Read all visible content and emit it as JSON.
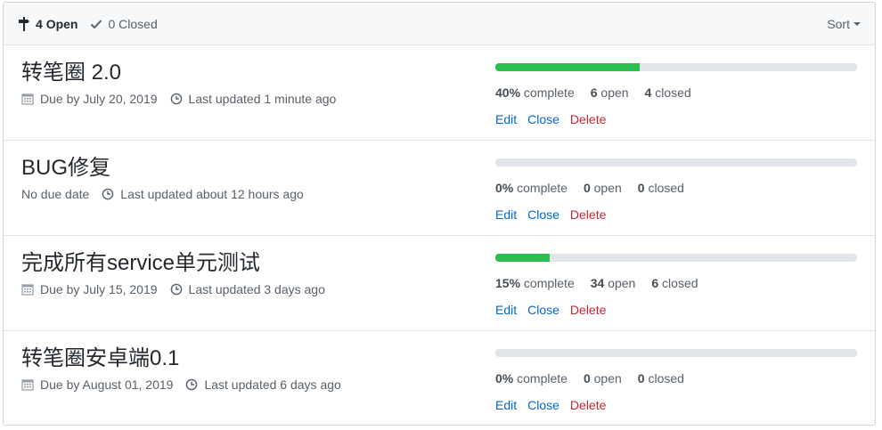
{
  "header": {
    "open_count": "4",
    "open_label": "Open",
    "closed_count": "0",
    "closed_label": "Closed",
    "sort_label": "Sort"
  },
  "milestones": [
    {
      "title": "转笔圈 2.0",
      "due": "Due by July 20, 2019",
      "has_due_icon": true,
      "updated": "Last updated 1 minute ago",
      "percent": 40,
      "percent_text": "40%",
      "complete_label": "complete",
      "open": "6",
      "open_label": "open",
      "closed": "4",
      "closed_label": "closed",
      "edit": "Edit",
      "close": "Close",
      "delete": "Delete"
    },
    {
      "title": "BUG修复",
      "due": "No due date",
      "has_due_icon": false,
      "updated": "Last updated about 12 hours ago",
      "percent": 0,
      "percent_text": "0%",
      "complete_label": "complete",
      "open": "0",
      "open_label": "open",
      "closed": "0",
      "closed_label": "closed",
      "edit": "Edit",
      "close": "Close",
      "delete": "Delete"
    },
    {
      "title": "完成所有service单元测试",
      "due": "Due by July 15, 2019",
      "has_due_icon": true,
      "updated": "Last updated 3 days ago",
      "percent": 15,
      "percent_text": "15%",
      "complete_label": "complete",
      "open": "34",
      "open_label": "open",
      "closed": "6",
      "closed_label": "closed",
      "edit": "Edit",
      "close": "Close",
      "delete": "Delete"
    },
    {
      "title": "转笔圈安卓端0.1",
      "due": "Due by August 01, 2019",
      "has_due_icon": true,
      "updated": "Last updated 6 days ago",
      "percent": 0,
      "percent_text": "0%",
      "complete_label": "complete",
      "open": "0",
      "open_label": "open",
      "closed": "0",
      "closed_label": "closed",
      "edit": "Edit",
      "close": "Close",
      "delete": "Delete"
    }
  ],
  "colors": {
    "progress_fill": "#2cbe4e",
    "link": "#0366d6",
    "danger": "#cb2431"
  }
}
